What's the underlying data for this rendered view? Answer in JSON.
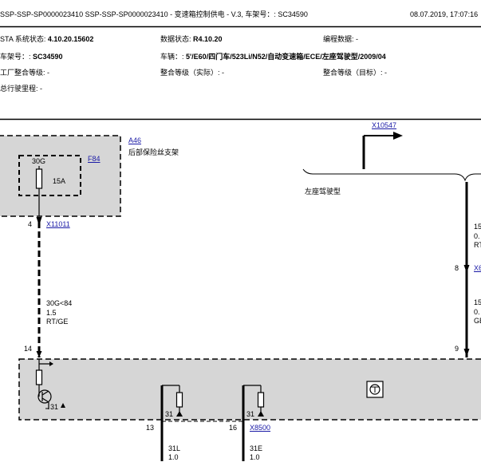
{
  "header": {
    "title": "SSP-SSP-SP0000023410 SSP-SSP-SP0000023410 - 变速箱控制供电 - V.3, 车架号：: SC34590",
    "date": "08.07.2019, 17:07:16"
  },
  "info": {
    "ista_label": "STA 系统状态:",
    "ista_value": "4.10.20.15602",
    "data_label": "数据状态:",
    "data_value": "R4.10.20",
    "prog_label": "编程数据: -",
    "vin_label": "车架号：:",
    "vin_value": "SC34590",
    "vehicle_label": "车辆：:",
    "vehicle_value": "5'/E60/四门车/523Li/N52/自动变速箱/ECE/左座驾驶型/2009/04",
    "factory_level": "工厂整合等级: -",
    "actual_level": "整合等级（实际）: -",
    "target_level": "整合等级（目标）: -",
    "mileage": "总行驶里程: -"
  },
  "diagram": {
    "a46_ref": "A46",
    "a46_desc": "后部保险丝支架",
    "fuse_code": "30G",
    "fuse_ref": "F84",
    "fuse_rating": "15A",
    "x10547_ref": "X10547",
    "left_drive": "左座驾驶型",
    "pin_4": "4",
    "x11011_ref": "X11011",
    "wire_left": [
      "30G<84",
      "1.5",
      "RT/GE"
    ],
    "pin_8": "8",
    "x6_partial": "X6",
    "wire_right_top": [
      "15",
      "0.",
      "RT"
    ],
    "wire_right_bottom": [
      "15",
      "0.",
      "GE"
    ],
    "pin_9": "9",
    "pin_14": "14",
    "label_31_a": "31",
    "label_31_b": "31",
    "label_31_c": "31",
    "pin_13": "13",
    "pin_16": "16",
    "x8500_ref": "X8500",
    "wire_31l": [
      "31L",
      "1.0"
    ],
    "wire_31e": [
      "31E",
      "1.0"
    ]
  }
}
